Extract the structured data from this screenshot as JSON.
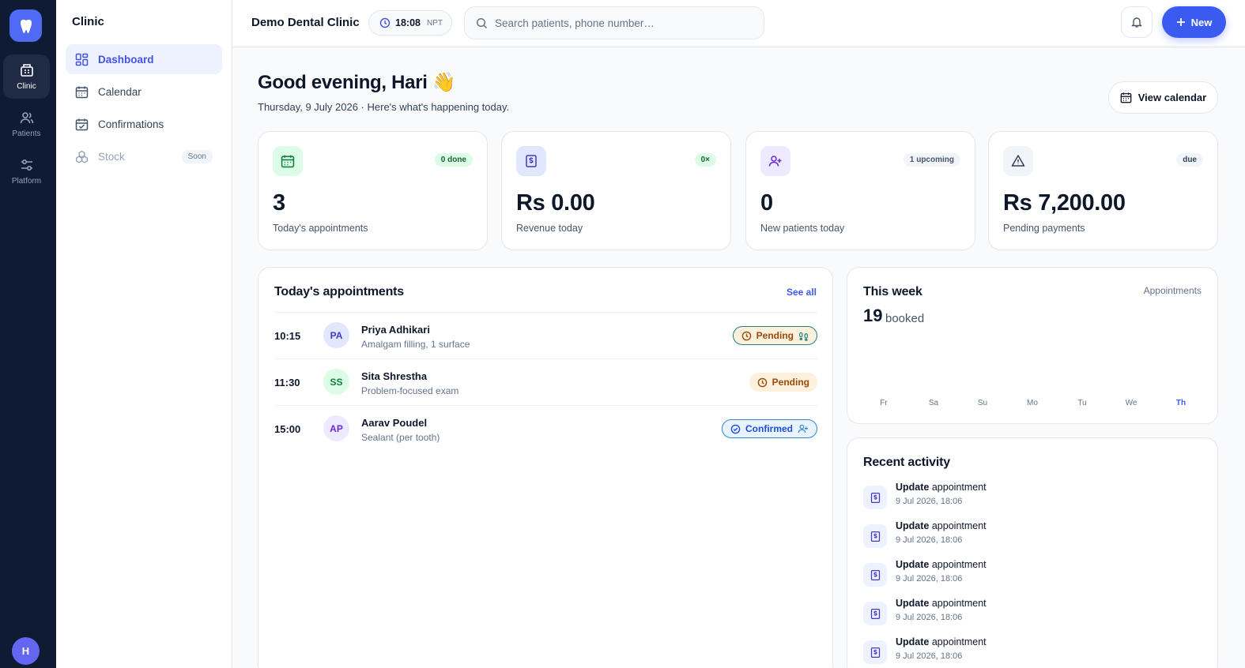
{
  "rail": {
    "items": [
      {
        "label": "Clinic"
      },
      {
        "label": "Patients"
      },
      {
        "label": "Platform"
      }
    ],
    "avatar_initial": "H"
  },
  "sidebar": {
    "title": "Clinic",
    "items": [
      {
        "label": "Dashboard"
      },
      {
        "label": "Calendar"
      },
      {
        "label": "Confirmations"
      },
      {
        "label": "Stock",
        "badge": "Soon"
      }
    ]
  },
  "header": {
    "clinic_name": "Demo Dental Clinic",
    "time": "18:08",
    "timezone": "NPT",
    "search_placeholder": "Search patients, phone number…",
    "new_label": "New"
  },
  "greeting": {
    "title": "Good evening, Hari",
    "emoji": "👋",
    "subline": "Thursday, 9 July 2026 · Here's what's happening today.",
    "view_calendar_label": "View calendar"
  },
  "stats": [
    {
      "value": "3",
      "label": "Today's appointments",
      "badge": "0 done"
    },
    {
      "value": "Rs 0.00",
      "label": "Revenue today",
      "badge": "0×"
    },
    {
      "value": "0",
      "label": "New patients today",
      "badge": "1 upcoming"
    },
    {
      "value": "Rs 7,200.00",
      "label": "Pending payments",
      "badge": "due"
    }
  ],
  "appointments": {
    "title": "Today's appointments",
    "see_all": "See all",
    "rows": [
      {
        "time": "10:15",
        "initials": "PA",
        "name": "Priya Adhikari",
        "procedure": "Amalgam filling, 1 surface",
        "status": "Pending"
      },
      {
        "time": "11:30",
        "initials": "SS",
        "name": "Sita Shrestha",
        "procedure": "Problem-focused exam",
        "status": "Pending"
      },
      {
        "time": "15:00",
        "initials": "AP",
        "name": "Aarav Poudel",
        "procedure": "Sealant (per tooth)",
        "status": "Confirmed"
      }
    ]
  },
  "week": {
    "title": "This week",
    "subtitle": "Appointments",
    "booked_count": "19",
    "booked_label": "booked",
    "days": [
      "Fr",
      "Sa",
      "Su",
      "Mo",
      "Tu",
      "We",
      "Th"
    ]
  },
  "activity": {
    "title": "Recent activity",
    "items": [
      {
        "action": "Update",
        "object": "appointment",
        "time": "9 Jul 2026, 18:06"
      },
      {
        "action": "Update",
        "object": "appointment",
        "time": "9 Jul 2026, 18:06"
      },
      {
        "action": "Update",
        "object": "appointment",
        "time": "9 Jul 2026, 18:06"
      },
      {
        "action": "Update",
        "object": "appointment",
        "time": "9 Jul 2026, 18:06"
      },
      {
        "action": "Update",
        "object": "appointment",
        "time": "9 Jul 2026, 18:06"
      }
    ]
  },
  "colors": {
    "accent": "#3b5bf0",
    "rail_bg": "#0f1a33",
    "pending_bg": "#fdf0dc",
    "confirmed_bg": "#e8f3fe"
  }
}
